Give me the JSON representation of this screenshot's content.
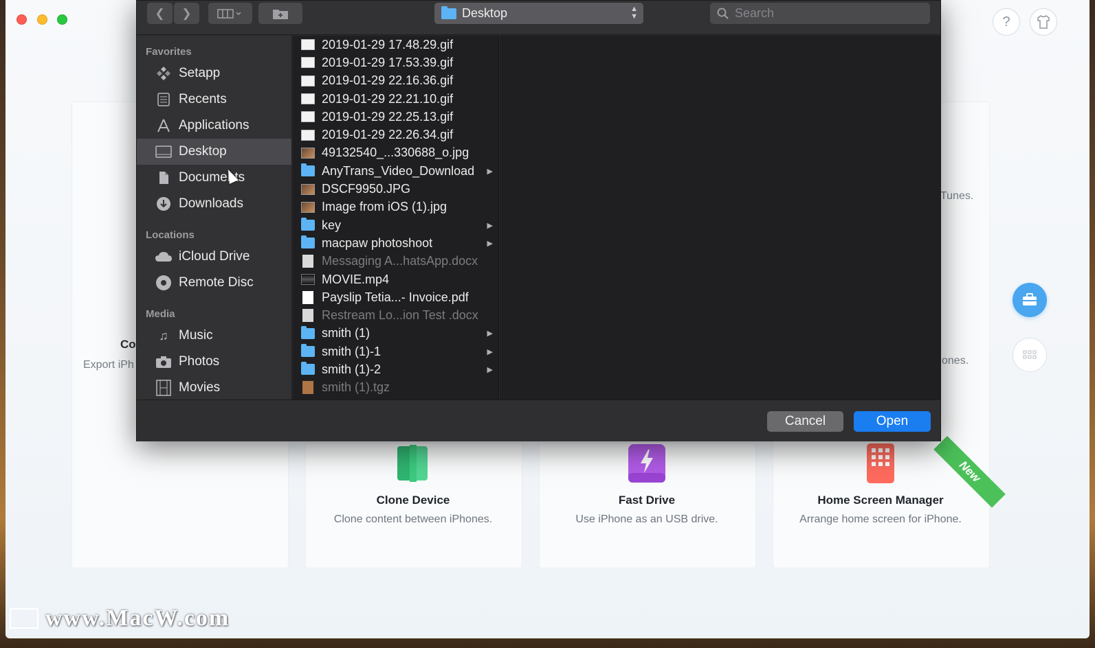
{
  "app": {
    "help_icon": "?",
    "left_card": {
      "title": "Co",
      "desc": "Export iPh"
    },
    "right_card_top": "Tunes.",
    "right_card_mid": "ones.",
    "features": [
      {
        "title": "Clone Device",
        "desc": "Clone content between iPhones.",
        "icon": "clone-icon",
        "color": "#3ccb7f"
      },
      {
        "title": "Fast Drive",
        "desc": "Use iPhone as an USB drive.",
        "icon": "lightning-drive-icon",
        "color": "#b25ce8"
      },
      {
        "title": "Home Screen Manager",
        "desc": "Arrange home screen for iPhone.",
        "icon": "home-grid-icon",
        "color": "#ff6b5e"
      }
    ],
    "new_badge": "New",
    "accent": "#4aa6ef"
  },
  "dialog": {
    "path": "Desktop",
    "search_placeholder": "Search",
    "sidebar": {
      "favorites_label": "Favorites",
      "favorites": [
        {
          "label": "Setapp",
          "icon": "setapp-icon"
        },
        {
          "label": "Recents",
          "icon": "recents-icon"
        },
        {
          "label": "Applications",
          "icon": "applications-icon"
        },
        {
          "label": "Desktop",
          "icon": "desktop-icon",
          "selected": true
        },
        {
          "label": "Documents",
          "icon": "documents-icon"
        },
        {
          "label": "Downloads",
          "icon": "downloads-icon"
        }
      ],
      "locations_label": "Locations",
      "locations": [
        {
          "label": "iCloud Drive",
          "icon": "cloud-icon"
        },
        {
          "label": "Remote Disc",
          "icon": "disc-icon"
        }
      ],
      "media_label": "Media",
      "media": [
        {
          "label": "Music",
          "icon": "music-icon"
        },
        {
          "label": "Photos",
          "icon": "camera-icon"
        },
        {
          "label": "Movies",
          "icon": "film-icon"
        }
      ]
    },
    "files": [
      {
        "name": "2019-01-29 17.48.29.gif",
        "type": "gif"
      },
      {
        "name": "2019-01-29 17.53.39.gif",
        "type": "gif"
      },
      {
        "name": "2019-01-29 22.16.36.gif",
        "type": "gif"
      },
      {
        "name": "2019-01-29 22.21.10.gif",
        "type": "gif"
      },
      {
        "name": "2019-01-29 22.25.13.gif",
        "type": "gif"
      },
      {
        "name": "2019-01-29 22.26.34.gif",
        "type": "gif"
      },
      {
        "name": "49132540_...330688_o.jpg",
        "type": "photo"
      },
      {
        "name": "AnyTrans_Video_Download",
        "type": "folder"
      },
      {
        "name": "DSCF9950.JPG",
        "type": "photo"
      },
      {
        "name": "Image from iOS (1).jpg",
        "type": "photo"
      },
      {
        "name": "key",
        "type": "folder"
      },
      {
        "name": "macpaw photoshoot",
        "type": "folder"
      },
      {
        "name": "Messaging A...hatsApp.docx",
        "type": "doc",
        "dim": true
      },
      {
        "name": "MOVIE.mp4",
        "type": "movie"
      },
      {
        "name": "Payslip Tetia...- Invoice.pdf",
        "type": "pdf"
      },
      {
        "name": "Restream Lo...ion Test .docx",
        "type": "doc",
        "dim": true
      },
      {
        "name": "smith (1)",
        "type": "folder"
      },
      {
        "name": "smith (1)-1",
        "type": "folder"
      },
      {
        "name": "smith (1)-2",
        "type": "folder"
      },
      {
        "name": "smith (1).tgz",
        "type": "tgz",
        "dim": true
      }
    ],
    "cancel_label": "Cancel",
    "open_label": "Open",
    "open_color": "#1a7df0"
  },
  "watermark": "www.MacW.com"
}
